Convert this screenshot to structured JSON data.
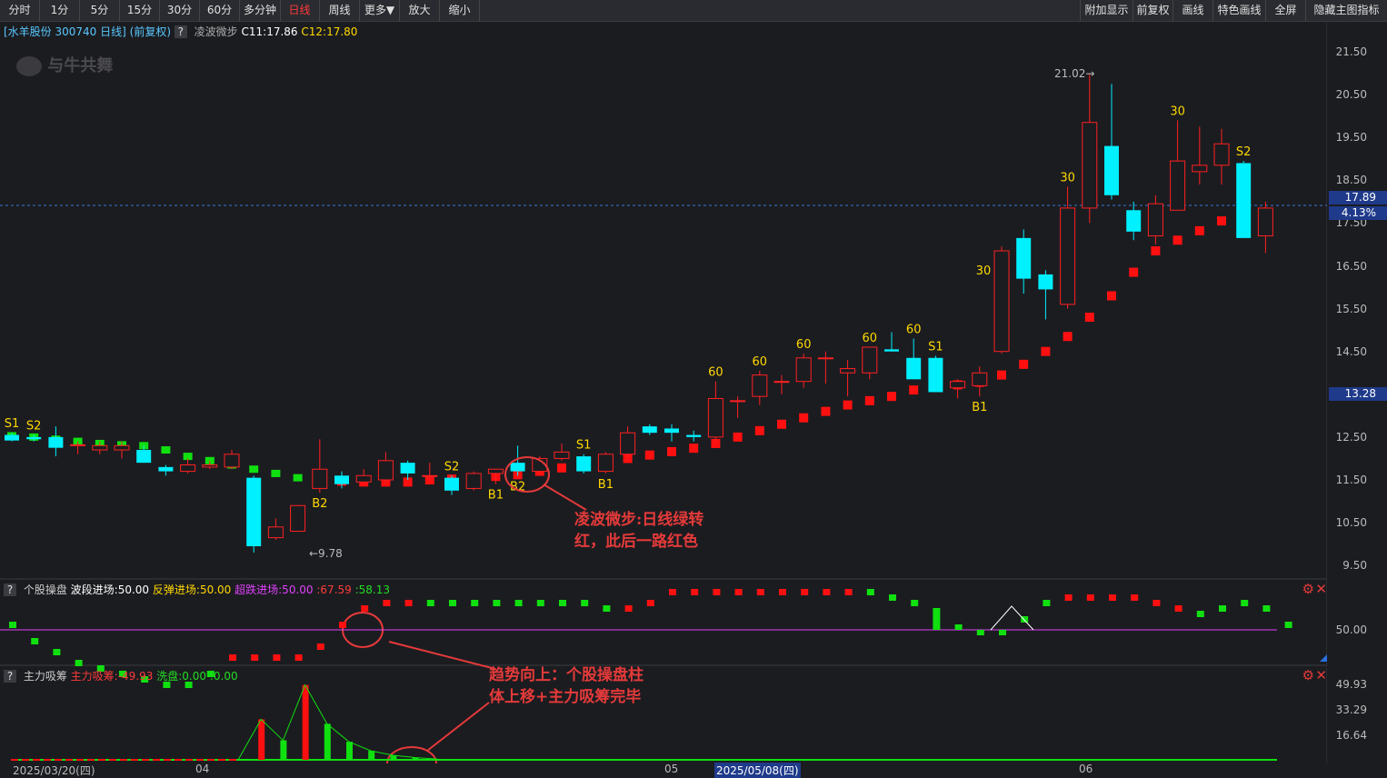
{
  "toolbar": {
    "left": [
      "分时",
      "1分",
      "5分",
      "15分",
      "30分",
      "60分",
      "多分钟",
      "日线",
      "周线",
      "更多▼",
      "放大",
      "缩小"
    ],
    "active": "日线",
    "right": [
      "附加显示",
      "前复权",
      "画线",
      "特色画线",
      "全屏",
      "隐藏主图指标"
    ]
  },
  "header": {
    "stock": "[水羊股份 300740 日线]",
    "adj": "(前复权)",
    "q": "?",
    "indicator": "凌波微步",
    "c1": "C11:17.86",
    "c2": "C12:17.80"
  },
  "watermark": "与牛共舞",
  "price_axis": [
    "21.50",
    "20.50",
    "19.50",
    "18.50",
    "17.50",
    "16.50",
    "15.50",
    "14.50",
    "13.50",
    "12.50",
    "11.50",
    "10.50",
    "9.50"
  ],
  "price_tags": {
    "current": "17.89",
    "pct": "4.13%",
    "low_mark": "13.28"
  },
  "price_marks": {
    "high": "21.02",
    "low": "9.78"
  },
  "colors": {
    "up": "#ff2020",
    "down": "#00f0ff",
    "green": "#00dd00",
    "label": "#ffd800",
    "annot": "#e53a3a"
  },
  "chart_data": {
    "type": "candlestick",
    "dates_shown": [
      "2025/03/20(四)",
      "04",
      "05",
      "2025/05/08(四)",
      "06"
    ],
    "candles": [
      {
        "o": 12.55,
        "h": 12.6,
        "l": 12.4,
        "c": 12.42
      },
      {
        "o": 12.5,
        "h": 12.55,
        "l": 12.4,
        "c": 12.45
      },
      {
        "o": 12.5,
        "h": 12.75,
        "l": 12.05,
        "c": 12.25
      },
      {
        "o": 12.3,
        "h": 12.4,
        "l": 12.1,
        "c": 12.32
      },
      {
        "o": 12.2,
        "h": 12.4,
        "l": 12.1,
        "c": 12.3
      },
      {
        "o": 12.2,
        "h": 12.4,
        "l": 12.0,
        "c": 12.3
      },
      {
        "o": 12.2,
        "h": 12.3,
        "l": 11.9,
        "c": 11.9
      },
      {
        "o": 11.8,
        "h": 11.85,
        "l": 11.6,
        "c": 11.7
      },
      {
        "o": 11.7,
        "h": 12.0,
        "l": 11.65,
        "c": 11.85
      },
      {
        "o": 11.8,
        "h": 11.95,
        "l": 11.75,
        "c": 11.85
      },
      {
        "o": 11.8,
        "h": 12.2,
        "l": 11.75,
        "c": 12.1
      },
      {
        "o": 11.55,
        "h": 11.6,
        "l": 9.8,
        "c": 9.95
      },
      {
        "o": 10.15,
        "h": 10.6,
        "l": 10.1,
        "c": 10.4
      },
      {
        "o": 10.3,
        "h": 10.9,
        "l": 10.3,
        "c": 10.9
      },
      {
        "o": 11.3,
        "h": 12.45,
        "l": 11.2,
        "c": 11.75
      },
      {
        "o": 11.6,
        "h": 11.7,
        "l": 11.3,
        "c": 11.4
      },
      {
        "o": 11.45,
        "h": 11.75,
        "l": 11.45,
        "c": 11.6
      },
      {
        "o": 11.5,
        "h": 12.15,
        "l": 11.45,
        "c": 11.95
      },
      {
        "o": 11.9,
        "h": 11.95,
        "l": 11.5,
        "c": 11.65
      },
      {
        "o": 11.6,
        "h": 11.9,
        "l": 11.5,
        "c": 11.6
      },
      {
        "o": 11.55,
        "h": 11.6,
        "l": 11.15,
        "c": 11.25
      },
      {
        "o": 11.3,
        "h": 11.7,
        "l": 11.25,
        "c": 11.65
      },
      {
        "o": 11.65,
        "h": 11.7,
        "l": 11.4,
        "c": 11.75
      },
      {
        "o": 11.9,
        "h": 12.3,
        "l": 11.6,
        "c": 11.7
      },
      {
        "o": 11.7,
        "h": 12.05,
        "l": 11.65,
        "c": 12.0
      },
      {
        "o": 12.0,
        "h": 12.35,
        "l": 11.95,
        "c": 12.15
      },
      {
        "o": 12.05,
        "h": 12.1,
        "l": 11.65,
        "c": 11.7
      },
      {
        "o": 11.7,
        "h": 12.15,
        "l": 11.65,
        "c": 12.1
      },
      {
        "o": 12.1,
        "h": 12.75,
        "l": 12.0,
        "c": 12.6
      },
      {
        "o": 12.75,
        "h": 12.8,
        "l": 12.55,
        "c": 12.6
      },
      {
        "o": 12.7,
        "h": 12.8,
        "l": 12.4,
        "c": 12.6
      },
      {
        "o": 12.55,
        "h": 12.65,
        "l": 12.4,
        "c": 12.5
      },
      {
        "o": 12.5,
        "h": 13.8,
        "l": 12.4,
        "c": 13.4
      },
      {
        "o": 13.35,
        "h": 13.45,
        "l": 12.95,
        "c": 13.35
      },
      {
        "o": 13.45,
        "h": 14.05,
        "l": 13.25,
        "c": 13.95
      },
      {
        "o": 13.8,
        "h": 13.95,
        "l": 13.5,
        "c": 13.8
      },
      {
        "o": 13.8,
        "h": 14.45,
        "l": 13.65,
        "c": 14.35
      },
      {
        "o": 14.35,
        "h": 14.5,
        "l": 13.75,
        "c": 14.35
      },
      {
        "o": 14.0,
        "h": 14.3,
        "l": 13.45,
        "c": 14.1
      },
      {
        "o": 14.0,
        "h": 14.6,
        "l": 13.85,
        "c": 14.6
      },
      {
        "o": 14.55,
        "h": 14.95,
        "l": 14.5,
        "c": 14.5
      },
      {
        "o": 14.35,
        "h": 14.8,
        "l": 13.95,
        "c": 13.85
      },
      {
        "o": 14.35,
        "h": 14.4,
        "l": 13.55,
        "c": 13.55
      },
      {
        "o": 13.65,
        "h": 13.85,
        "l": 13.4,
        "c": 13.8
      },
      {
        "o": 13.7,
        "h": 14.15,
        "l": 13.45,
        "c": 14.0
      },
      {
        "o": 14.5,
        "h": 16.95,
        "l": 14.45,
        "c": 16.85
      },
      {
        "o": 17.15,
        "h": 17.35,
        "l": 15.85,
        "c": 16.2
      },
      {
        "o": 16.3,
        "h": 16.4,
        "l": 15.25,
        "c": 15.95
      },
      {
        "o": 15.6,
        "h": 18.35,
        "l": 15.5,
        "c": 17.85
      },
      {
        "o": 17.85,
        "h": 21.0,
        "l": 17.5,
        "c": 19.85
      },
      {
        "o": 19.3,
        "h": 20.75,
        "l": 18.05,
        "c": 18.15
      },
      {
        "o": 17.8,
        "h": 18.0,
        "l": 17.1,
        "c": 17.3
      },
      {
        "o": 17.2,
        "h": 18.15,
        "l": 17.0,
        "c": 17.95
      },
      {
        "o": 17.8,
        "h": 19.9,
        "l": 17.85,
        "c": 18.95
      },
      {
        "o": 18.7,
        "h": 19.75,
        "l": 18.4,
        "c": 18.85
      },
      {
        "o": 18.85,
        "h": 19.7,
        "l": 18.4,
        "c": 19.35
      },
      {
        "o": 18.9,
        "h": 18.95,
        "l": 17.15,
        "c": 17.15
      },
      {
        "o": 17.2,
        "h": 18.0,
        "l": 16.8,
        "c": 17.85
      }
    ],
    "wave_line": [
      12.53,
      12.5,
      12.45,
      12.4,
      12.35,
      12.32,
      12.3,
      12.2,
      12.05,
      11.95,
      11.85,
      11.75,
      11.65,
      11.55,
      11.5,
      11.47,
      11.45,
      11.45,
      11.45,
      11.5,
      11.52,
      11.55,
      11.58,
      11.62,
      11.7,
      11.78,
      11.85,
      11.92,
      12.0,
      12.08,
      12.16,
      12.24,
      12.35,
      12.5,
      12.65,
      12.8,
      12.95,
      13.1,
      13.25,
      13.35,
      13.45,
      13.6,
      13.68,
      13.72,
      13.78,
      13.95,
      14.2,
      14.5,
      14.85,
      15.3,
      15.8,
      16.35,
      16.85,
      17.1,
      17.32,
      17.55,
      17.72
    ],
    "wave_signs": "GGGGGGGGGGGGGGRRRRRRRRRRRRRRRRRRRRRRRRRRRRRRRRRRRRRRRRRRRRRRR",
    "signals": [
      {
        "i": 0,
        "t": "S1",
        "pos": "above"
      },
      {
        "i": 1,
        "t": "S2",
        "pos": "above"
      },
      {
        "i": 14,
        "t": "B2",
        "pos": "below"
      },
      {
        "i": 20,
        "t": "S2",
        "pos": "above"
      },
      {
        "i": 22,
        "t": "B1",
        "pos": "below"
      },
      {
        "i": 23,
        "t": "B2",
        "pos": "below"
      },
      {
        "i": 26,
        "t": "S1",
        "pos": "above"
      },
      {
        "i": 27,
        "t": "B1",
        "pos": "below"
      },
      {
        "i": 32,
        "t": "60",
        "pos": "above"
      },
      {
        "i": 34,
        "t": "60",
        "pos": "above"
      },
      {
        "i": 36,
        "t": "60",
        "pos": "above"
      },
      {
        "i": 39,
        "t": "60",
        "pos": "above"
      },
      {
        "i": 41,
        "t": "60",
        "pos": "above"
      },
      {
        "i": 42,
        "t": "S1",
        "pos": "above"
      },
      {
        "i": 44,
        "t": "B1",
        "pos": "below"
      },
      {
        "i": 45,
        "t": "30",
        "pos": "left"
      },
      {
        "i": 48,
        "t": "30",
        "pos": "above"
      },
      {
        "i": 53,
        "t": "30",
        "pos": "above"
      },
      {
        "i": 56,
        "t": "S2",
        "pos": "above"
      }
    ],
    "panel1": {
      "title": "个股操盘",
      "l1": "波段进场:50.00",
      "l2": "反弹进场:50.00",
      "l3": "超跌进场:50.00",
      "v1": ":67.59",
      "v2": ":58.13",
      "axis": "50.00",
      "values": [
        51,
        48,
        46,
        44,
        43,
        42,
        41,
        40,
        40,
        42,
        45,
        45,
        45,
        45,
        47,
        51,
        54,
        55,
        55,
        55,
        55,
        55,
        55,
        55,
        55,
        55,
        55,
        54,
        54,
        55,
        57,
        57,
        57,
        57,
        57,
        57,
        57,
        57,
        57,
        57,
        56,
        55,
        54,
        51,
        49,
        49,
        52,
        55,
        56,
        56,
        56,
        56,
        55,
        54,
        53,
        54,
        55,
        54,
        51
      ],
      "signs": "GGGGGGGGGGRRRRRRRRRGGGGGGGGGRRRRRRRRRRRGGGGGGGGGRRRRRRGGGGGGG"
    },
    "panel2": {
      "title": "主力吸筹",
      "l1": "主力吸筹:-49.93",
      "l2": "洗盘:0.00",
      "l3": ":0.00",
      "axis": [
        "49.93",
        "33.29",
        "16.64"
      ],
      "bars": [
        {
          "i": 11,
          "v": 27,
          "c": "R"
        },
        {
          "i": 12,
          "v": 13,
          "c": "G"
        },
        {
          "i": 13,
          "v": 49.93,
          "c": "R"
        },
        {
          "i": 14,
          "v": 24,
          "c": "G"
        },
        {
          "i": 15,
          "v": 12,
          "c": "G"
        },
        {
          "i": 16,
          "v": 6,
          "c": "G"
        },
        {
          "i": 17,
          "v": 3,
          "c": "G"
        },
        {
          "i": 18,
          "v": 1.5,
          "c": "G"
        },
        {
          "i": 19,
          "v": 0.5,
          "c": "G"
        }
      ]
    }
  },
  "annotations": {
    "a1": [
      "凌波微步:日线绿转",
      "红，此后一路红色"
    ],
    "a2": [
      "趋势向上：个股操盘柱",
      "体上移+主力吸筹完毕"
    ]
  },
  "controls": {
    "gear": "⚙",
    "close": "✕"
  }
}
